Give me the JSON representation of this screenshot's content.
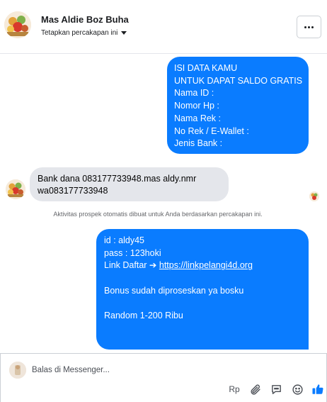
{
  "header": {
    "contact_name": "Mas Aldie Boz Buha",
    "conversation_setting": "Tetapkan percakapan ini",
    "more_icon": "ellipsis-icon"
  },
  "messages": [
    {
      "direction": "outgoing",
      "lines": [
        "ISI DATA KAMU",
        "UNTUK DAPAT SALDO GRATIS",
        "Nama ID :",
        "Nomor Hp :",
        "Nama Rek :",
        "No Rek / E-Wallet :",
        "Jenis Bank :"
      ]
    },
    {
      "direction": "incoming",
      "lines": [
        "Bank dana 083177733948.mas aldy.nmr",
        "wa083177733948"
      ]
    },
    {
      "direction": "system",
      "text": "Aktivitas prospek otomatis dibuat untuk Anda berdasarkan percakapan ini."
    },
    {
      "direction": "outgoing",
      "line1": "id : aldy45",
      "line2": "pass : 123hoki",
      "link_prefix": "Link Daftar ➔ ",
      "link_text": "https://linkpelangi4d.org",
      "line4": "Bonus sudah diproseskan ya bosku",
      "line5": "Random 1-200 Ribu"
    }
  ],
  "composer": {
    "placeholder": "Balas di Messenger...",
    "tools": {
      "currency_label": "Rp",
      "attach_icon": "paperclip-icon",
      "saved_reply_icon": "chat-bubble-icon",
      "emoji_icon": "emoji-icon",
      "like_icon": "thumbs-up-icon"
    }
  },
  "colors": {
    "outgoing_bubble": "#0a7cff",
    "incoming_bubble": "#e4e6eb",
    "like_icon": "#0a7cff"
  }
}
